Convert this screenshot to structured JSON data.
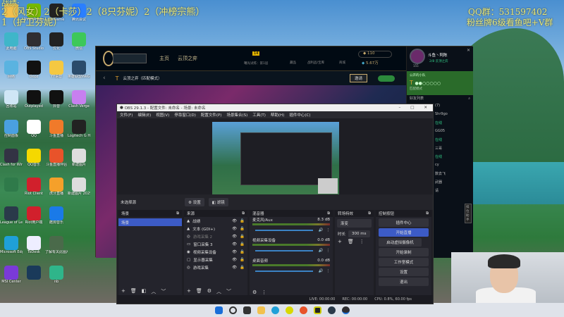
{
  "overlay": {
    "line0": "战绩:",
    "line1": "2（风女）2（卡莎）2（8只芬妮）2（冲榜宗熊）",
    "line2": "1（护卫芬妮）",
    "qq": "QQ群：531597402",
    "fans": "粉丝牌6级看鱼吧+V群"
  },
  "desktop_icons": [
    {
      "label": "",
      "color": "#f2c14e"
    },
    {
      "label": "NVIDIA App",
      "color": "#76b900"
    },
    {
      "label": "WeGame",
      "color": "#222"
    },
    {
      "label": "腾讯会议",
      "color": "#2a7fff"
    },
    {
      "label": "此电脑",
      "color": "#3fb6c9"
    },
    {
      "label": "OBS Studio",
      "color": "#302e31"
    },
    {
      "label": "优化",
      "color": "#222"
    },
    {
      "label": "微信",
      "color": "#3dc85a"
    },
    {
      "label": "网络",
      "color": "#5ab3e0"
    },
    {
      "label": "Oopz",
      "color": "#111"
    },
    {
      "label": "YY语音",
      "color": "#f5c842"
    },
    {
      "label": "英雄联盟WeGame版",
      "color": "#2a4b6b"
    },
    {
      "label": "回收站",
      "color": "#cfe6f5"
    },
    {
      "label": "Outplayed",
      "color": "#111"
    },
    {
      "label": "抖音",
      "color": "#111"
    },
    {
      "label": "Clash Verge",
      "color": "#c77ff0"
    },
    {
      "label": "控制面板",
      "color": "#4aa0e0"
    },
    {
      "label": "QQ",
      "color": "#fff"
    },
    {
      "label": "斗鱼直播",
      "color": "#f07a2a"
    },
    {
      "label": "Logitech G HUB",
      "color": "#222"
    },
    {
      "label": "Clash for Windows",
      "color": "#334"
    },
    {
      "label": "QQ音乐",
      "color": "#f5d800"
    },
    {
      "label": "斗鱼直播伴侣",
      "color": "#e8532a"
    },
    {
      "label": "新建图片",
      "color": "#ddd"
    },
    {
      "label": "",
      "color": "#2f7a4a"
    },
    {
      "label": "Riot Client",
      "color": "#d1202c"
    },
    {
      "label": "虎牙直播",
      "color": "#f5a02a"
    },
    {
      "label": "新建图片 2025090",
      "color": "#ddd"
    },
    {
      "label": "League of Legends",
      "color": "#2a3a4a"
    },
    {
      "label": "Riot用户端",
      "color": "#d1202c"
    },
    {
      "label": "酷狗音乐",
      "color": "#1a7ae8"
    },
    {
      "label": "",
      "color": "transparent"
    },
    {
      "label": "Microsoft Edge",
      "color": "#1fa0d8"
    },
    {
      "label": "ToDesk",
      "color": "#eef"
    },
    {
      "label": "了解有关此图片的信息",
      "color": "#4a6a4a"
    },
    {
      "label": "",
      "color": "transparent"
    },
    {
      "label": "MSI Center",
      "color": "#7a3ad8"
    },
    {
      "label": "",
      "color": "#1a3a5a"
    },
    {
      "label": "nb",
      "color": "#2fb58a"
    },
    {
      "label": "",
      "color": "transparent"
    }
  ],
  "lol": {
    "nav_home": "主页",
    "nav_tft": "云顶之弈",
    "pass": "曙光试炼：第1层",
    "pass_level": "14",
    "loot": "藏品",
    "collection": "战利品/宝库",
    "store": "商城",
    "be": "110",
    "rp": "5.67万",
    "summoner": "斗鱼丶阿陈",
    "status": "2/8 云顶之弈",
    "level": "155",
    "mode": "云顶之弈（匹配模式）",
    "invite": "邀请",
    "party": "公开的小队",
    "party_mode": "匹配模式",
    "friends": "好友列表",
    "friend_items": [
      "(7)",
      "Shr9go",
      "在线",
      "GG05",
      "在线",
      "三哥",
      "在线",
      "cy",
      "数去飞",
      "武器",
      "请"
    ],
    "assistant": "排位助手"
  },
  "obs": {
    "title": "OBS 29.1.3 - 配置文件: 未命名 - 场景: 未命名",
    "menu": [
      "文件(F)",
      "编辑(E)",
      "视图(V)",
      "停靠窗口(D)",
      "配置文件(P)",
      "场景集合(S)",
      "工具(T)",
      "帮助(H)",
      "插件中心(C)"
    ],
    "no_source": "未选择源",
    "props": "设置",
    "filters": "滤镜",
    "scenes_title": "场景",
    "scenes": [
      "场景"
    ],
    "sources_title": "来源",
    "sources": [
      "战绩",
      "文本 (GDI+)",
      "游戏采集 2",
      "窗口采集 3",
      "视频采集设备",
      "显示器采集",
      "游戏采集"
    ],
    "mixer_title": "混音器",
    "mixer": [
      {
        "name": "麦克风/Aux",
        "db": "8.3 dB"
      },
      {
        "name": "视频采集设备",
        "db": "0.0 dB"
      },
      {
        "name": "桌面音频",
        "db": "0.0 dB"
      }
    ],
    "trans_title": "转场特效",
    "trans": "渐变",
    "duration_label": "时长",
    "duration": "300 ms",
    "controls_title": "控制按钮",
    "controls": [
      "插件中心",
      "开始直播",
      "启动虚拟摄像机",
      "开始录制",
      "工作室模式",
      "设置",
      "退出"
    ],
    "live": "LIVE: 00:00:00",
    "rec": "REC: 00:00:00",
    "cpu": "CPU: 0.8%, 60.00 fps"
  },
  "colors": {
    "accent": "#3c5bc6",
    "lol_gold": "#c8aa6e",
    "overlay": "#e6e87a"
  }
}
